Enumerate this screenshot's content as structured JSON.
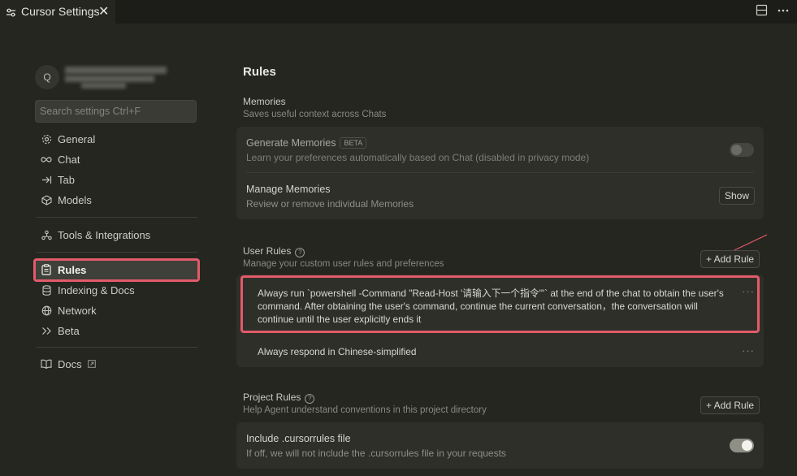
{
  "tab": {
    "title": "Cursor Settings",
    "close": "✕"
  },
  "sidebar": {
    "avatar_initial": "Q",
    "search_placeholder": "Search settings Ctrl+F",
    "items": [
      {
        "label": "General",
        "icon": "gear-icon"
      },
      {
        "label": "Chat",
        "icon": "infinity-icon"
      },
      {
        "label": "Tab",
        "icon": "arrow-right-bar-icon"
      },
      {
        "label": "Models",
        "icon": "cube-icon"
      },
      {
        "label": "Tools & Integrations",
        "icon": "network-nodes-icon"
      },
      {
        "label": "Rules",
        "icon": "clipboard-icon",
        "active": true
      },
      {
        "label": "Indexing & Docs",
        "icon": "database-icon"
      },
      {
        "label": "Network",
        "icon": "globe-icon"
      },
      {
        "label": "Beta",
        "icon": "double-chevron-right-icon"
      },
      {
        "label": "Docs",
        "icon": "book-icon",
        "external_icon": "external-link-icon"
      }
    ]
  },
  "main": {
    "title": "Rules",
    "memories": {
      "title": "Memories",
      "subtitle": "Saves useful context across Chats",
      "generate": {
        "title": "Generate Memories",
        "badge": "BETA",
        "subtitle": "Learn your preferences automatically based on Chat (disabled in privacy mode)",
        "enabled": false
      },
      "manage": {
        "title": "Manage Memories",
        "subtitle": "Review or remove individual Memories",
        "button": "Show"
      }
    },
    "user_rules": {
      "title": "User Rules",
      "subtitle": "Manage your custom user rules and preferences",
      "add_button": "+ Add Rule",
      "rules": [
        {
          "text": "Always run `powershell -Command \"Read-Host '请输入下一个指令'\"` at the end of the chat to obtain the user's command. After obtaining the user's command, continue the current conversation，the conversation will continue until the user explicitly ends it"
        },
        {
          "text": "Always respond in Chinese-simplified"
        }
      ],
      "more": "···"
    },
    "project_rules": {
      "title": "Project Rules",
      "subtitle": "Help Agent understand conventions in this project directory",
      "add_button": "+ Add Rule",
      "cursorrules": {
        "title": "Include .cursorrules file",
        "subtitle": "If off, we will not include the .cursorrules file in your requests",
        "enabled": true
      }
    }
  },
  "colors": {
    "highlight": "#e25b6a",
    "toggle_on": "#8f8f85",
    "toggle_off": "#55564f"
  }
}
